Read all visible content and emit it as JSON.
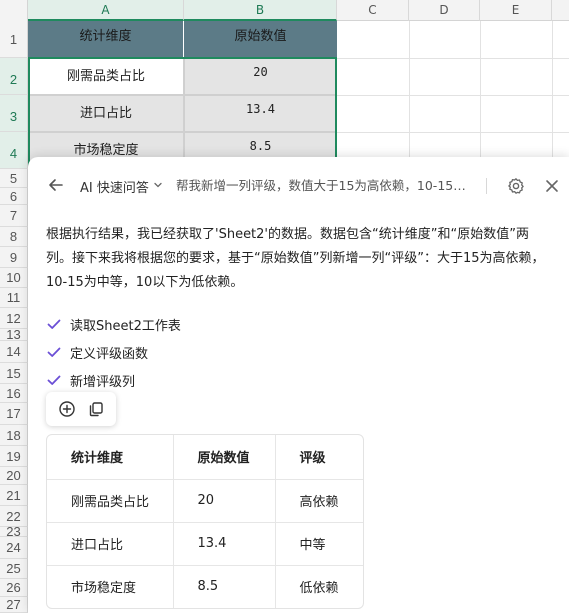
{
  "sheet": {
    "columns": [
      "A",
      "B",
      "C",
      "D",
      "E"
    ],
    "rows": [
      "1",
      "2",
      "3",
      "4",
      "5",
      "6",
      "7",
      "8",
      "9",
      "10",
      "11",
      "12",
      "13",
      "14",
      "15",
      "16",
      "17",
      "18",
      "19",
      "20",
      "21",
      "22",
      "23",
      "24",
      "25",
      "26",
      "27"
    ],
    "header": {
      "a": "统计维度",
      "b": "原始数值"
    },
    "data": [
      {
        "a": "刚需品类占比",
        "b": "20"
      },
      {
        "a": "进口占比",
        "b": "13.4"
      },
      {
        "a": "市场稳定度",
        "b": "8.5"
      }
    ]
  },
  "panel": {
    "mode": "AI 快速问答",
    "query": "帮我新增一列评级，数值大于15为高依赖，10-15为中等，10以下为低依赖",
    "answer": "根据执行结果，我已经获取了'Sheet2'的数据。数据包含“统计维度”和“原始数值”两列。接下来我将根据您的要求，基于“原始数值”列新增一列“评级”：大于15为高依赖，10-15为中等，10以下为低依赖。",
    "steps": [
      "读取Sheet2工作表",
      "定义评级函数",
      "新增评级列"
    ],
    "result_table": {
      "headers": [
        "统计维度",
        "原始数值",
        "评级"
      ],
      "rows": [
        [
          "刚需品类占比",
          "20",
          "高依赖"
        ],
        [
          "进口占比",
          "13.4",
          "中等"
        ],
        [
          "市场稳定度",
          "8.5",
          "低依赖"
        ]
      ]
    },
    "icons": {
      "back": "arrow-left-icon",
      "chevron": "chevron-down-icon",
      "settings": "gear-icon",
      "close": "close-icon",
      "check": "check-icon",
      "add": "add-circle-icon",
      "copy": "copy-icon"
    },
    "accent_color": "#6b4fd6"
  }
}
